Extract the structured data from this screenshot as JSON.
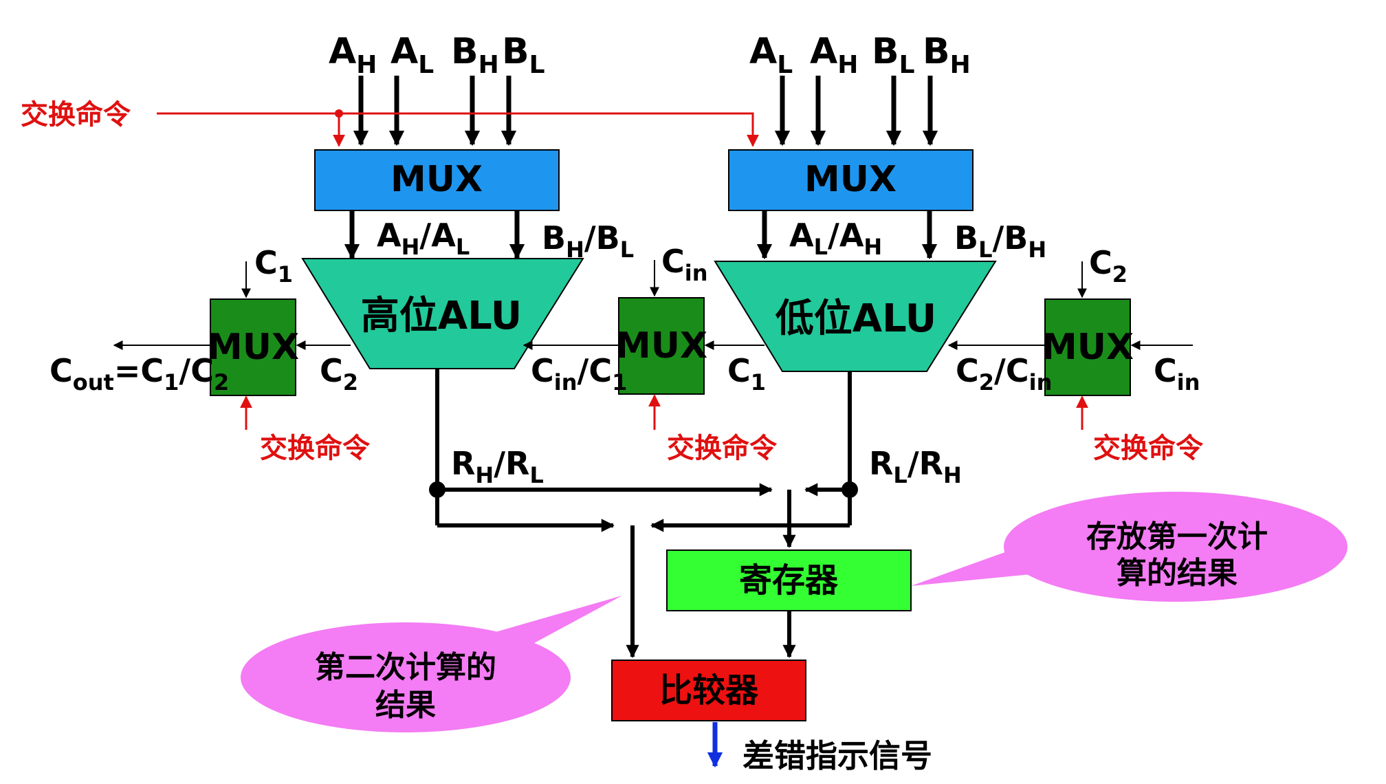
{
  "inputs": {
    "left": [
      {
        "main": "A",
        "sub": "H"
      },
      {
        "main": "A",
        "sub": "L"
      },
      {
        "main": "B",
        "sub": "H"
      },
      {
        "main": "B",
        "sub": "L"
      }
    ],
    "right": [
      {
        "main": "A",
        "sub": "L"
      },
      {
        "main": "A",
        "sub": "H"
      },
      {
        "main": "B",
        "sub": "L"
      },
      {
        "main": "B",
        "sub": "H"
      }
    ]
  },
  "swap_command": "交换命令",
  "mux_label": "MUX",
  "alu_high": "高位ALU",
  "alu_low": "低位ALU",
  "register": "寄存器",
  "comparator": "比较器",
  "error_signal": "差错指示信号",
  "callout_register": [
    "存放第一次计",
    "算的结果"
  ],
  "callout_second": [
    "第二次计算的",
    "结果"
  ],
  "signals": {
    "left_alu_a": {
      "a": "A",
      "as": "H",
      "sep": "/",
      "b": "A",
      "bs": "L"
    },
    "left_alu_b": {
      "a": "B",
      "as": "H",
      "sep": "/",
      "b": "B",
      "bs": "L"
    },
    "right_alu_a": {
      "a": "A",
      "as": "L",
      "sep": "/",
      "b": "A",
      "bs": "H"
    },
    "right_alu_b": {
      "a": "B",
      "as": "L",
      "sep": "/",
      "b": "B",
      "bs": "H"
    },
    "c1": {
      "a": "C",
      "as": "1"
    },
    "c2": {
      "a": "C",
      "as": "2"
    },
    "cin": {
      "a": "C",
      "as": "in"
    },
    "cout": {
      "a": "C",
      "as": "out",
      "eq": "=",
      "b": "C",
      "bs": "1",
      "sep": "/",
      "c": "C",
      "cs": "2"
    },
    "cin_c1": {
      "a": "C",
      "as": "in",
      "sep": "/",
      "b": "C",
      "bs": "1"
    },
    "c2_cin": {
      "a": "C",
      "as": "2",
      "sep": "/",
      "b": "C",
      "bs": "in"
    },
    "rh_rl": {
      "a": "R",
      "as": "H",
      "sep": "/",
      "b": "R",
      "bs": "L"
    },
    "rl_rh": {
      "a": "R",
      "as": "L",
      "sep": "/",
      "b": "R",
      "bs": "H"
    }
  },
  "colors": {
    "mux_top": "#1e96f0",
    "alu": "#22c99a",
    "mux_small": "#1a8c1a",
    "register": "#33ff33",
    "comparator": "#ee1111",
    "callout": "#f47cf4",
    "swap": "#e01010",
    "error_arrow": "#1030e0"
  }
}
